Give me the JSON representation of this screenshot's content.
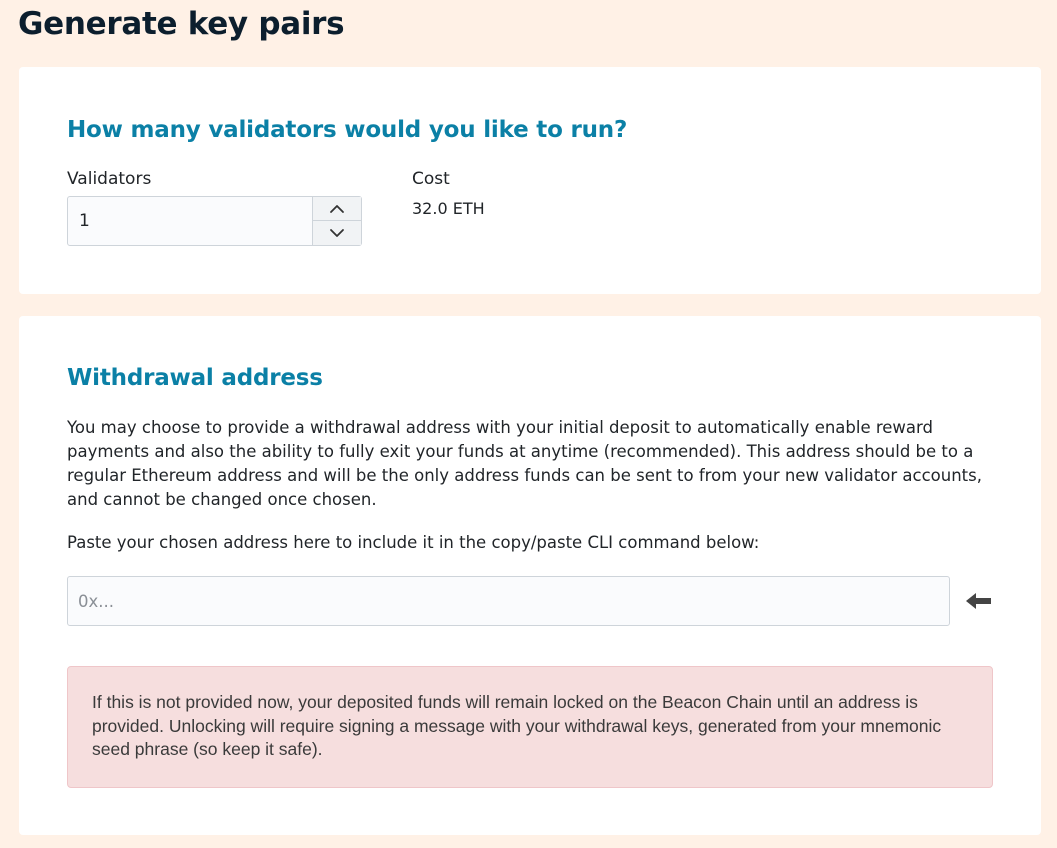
{
  "page": {
    "title": "Generate key pairs"
  },
  "validators_card": {
    "heading": "How many validators would you like to run?",
    "validators_label": "Validators",
    "validators_value": "1",
    "cost_label": "Cost",
    "cost_value": "32.0 ETH",
    "stepper_up_icon": "chevron-up-icon",
    "stepper_down_icon": "chevron-down-icon"
  },
  "withdrawal_card": {
    "heading": "Withdrawal address",
    "description": "You may choose to provide a withdrawal address with your initial deposit to automatically enable reward payments and also the ability to fully exit your funds at anytime (recommended). This address should be to a regular Ethereum address and will be the only address funds can be sent to from your new validator accounts, and cannot be changed once chosen.",
    "paste_label": "Paste your chosen address here to include it in the copy/paste CLI command below:",
    "address_placeholder": "0x...",
    "address_value": "",
    "arrow_icon": "arrow-left-icon",
    "warning_text": "If this is not provided now, your deposited funds will remain locked on the Beacon Chain until an address is provided. Unlocking will require signing a message with your withdrawal keys, generated from your mnemonic seed phrase (so keep it safe)."
  },
  "colors": {
    "background": "#fff1e6",
    "heading_accent": "#0b80a6",
    "title": "#0c1e2d",
    "alert_bg": "#f6dede",
    "alert_border": "#efc6c9"
  }
}
